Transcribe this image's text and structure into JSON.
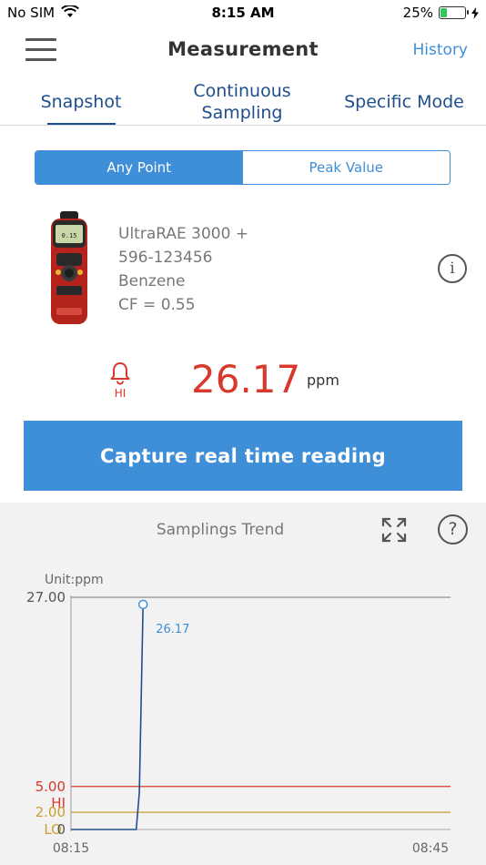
{
  "status_bar": {
    "carrier": "No SIM",
    "time": "8:15 AM",
    "battery": "25%",
    "battery_level": 0.25
  },
  "header": {
    "title": "Measurement",
    "history": "History"
  },
  "tabs": [
    {
      "label": "Snapshot",
      "active": true
    },
    {
      "label_line1": "Continuous",
      "label_line2": "Sampling",
      "active": false
    },
    {
      "label": "Specific Mode",
      "active": false
    }
  ],
  "segment": {
    "options": [
      "Any Point",
      "Peak Value"
    ],
    "selected": "Any Point"
  },
  "device": {
    "model": "UltraRAE 3000 +",
    "serial": "596-123456",
    "gas": "Benzene",
    "cf": "CF = 0.55",
    "screen_value": "0.15"
  },
  "reading": {
    "alarm": "HI",
    "value": "26.17",
    "unit": "ppm"
  },
  "capture_button": "Capture real time reading",
  "trend": {
    "title": "Samplings Trend"
  },
  "colors": {
    "accent": "#3e8ed8",
    "alarm": "#d8392c",
    "hi_line": "#d8392c",
    "lo_line": "#c8a030",
    "dark_blue": "#1f4e8c"
  },
  "chart_data": {
    "type": "line",
    "unit_label": "Unit:ppm",
    "y_ticks": [
      "27.00",
      "5.00",
      "2.00",
      "0"
    ],
    "ylim": [
      0,
      27
    ],
    "x_ticks": [
      "08:15",
      "08:45"
    ],
    "thresholds": [
      {
        "name": "HI",
        "value": 5.0
      },
      {
        "name": "LO",
        "value": 2.0
      }
    ],
    "series": [
      {
        "points": [
          {
            "x": 0.0,
            "y": 0
          },
          {
            "x": 0.172,
            "y": 0
          },
          {
            "x": 0.18,
            "y": 4.3
          },
          {
            "x": 0.19,
            "y": 26.17
          }
        ]
      }
    ],
    "peak_label": "26.17"
  }
}
